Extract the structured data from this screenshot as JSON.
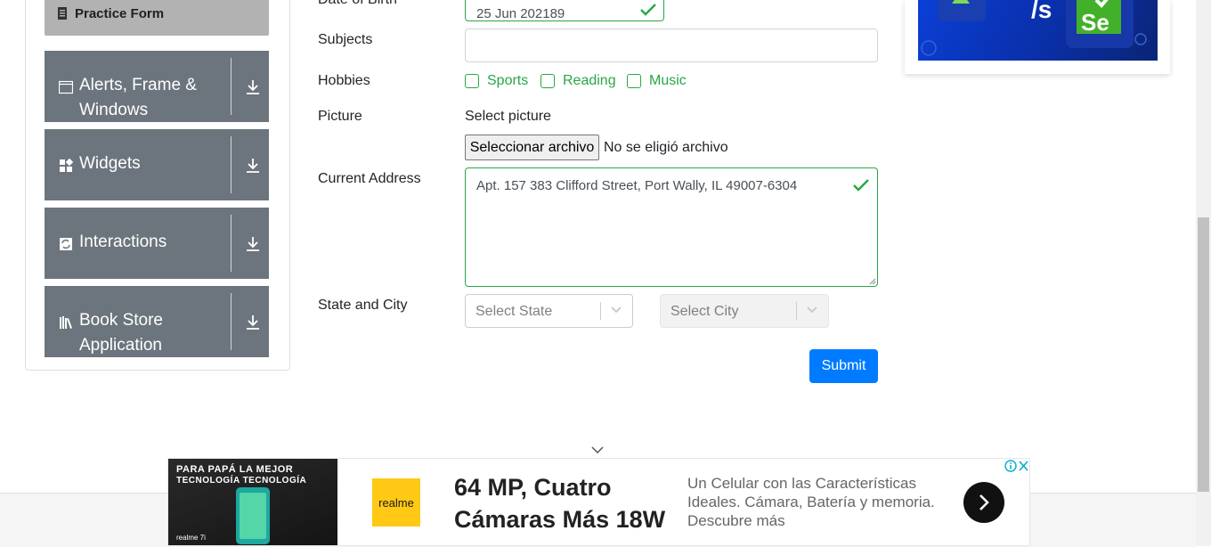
{
  "sidebar": {
    "practice_form_label": "Practice Form",
    "groups": [
      {
        "label": "Alerts, Frame & Windows",
        "icon": "window-icon"
      },
      {
        "label": "Widgets",
        "icon": "widgets-icon"
      },
      {
        "label": "Interactions",
        "icon": "interactions-icon"
      },
      {
        "label": "Book Store Application",
        "icon": "books-icon"
      }
    ]
  },
  "form": {
    "dob_label": "Date of Birth",
    "dob_value": "25 Jun 202189",
    "subjects_label": "Subjects",
    "subjects_value": "",
    "hobbies_label": "Hobbies",
    "hobbies": [
      "Sports",
      "Reading",
      "Music"
    ],
    "picture_label": "Picture",
    "picture_title": "Select picture",
    "file_button": "Seleccionar archivo",
    "file_status": "No se eligió archivo",
    "address_label": "Current Address",
    "address_value": "Apt. 157 383 Clifford Street, Port Wally, IL 49007-6304",
    "state_city_label": "State and City",
    "state_placeholder": "Select State",
    "city_placeholder": "Select City",
    "submit": "Submit"
  },
  "bottom_ad": {
    "image_line1": "PARA PAPÁ LA MEJOR",
    "image_line2": "TECNOLOGÍA TECNOLOGÍA",
    "image_brand": "realme 7i",
    "logo_text": "realme",
    "headline_line1": "64 MP, Cuatro",
    "headline_line2": "Cámaras Más 18W",
    "description": "Un Celular con las Características Ideales. Cámara, Batería y memoria. Descubre más"
  },
  "colors": {
    "sidebar_group": "#6c757d",
    "active_item": "#b2b2b2",
    "valid_green": "#28a745",
    "primary": "#007bff"
  }
}
